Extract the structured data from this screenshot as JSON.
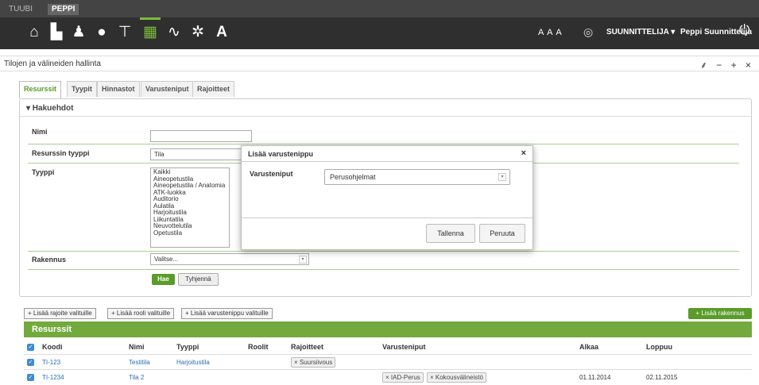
{
  "app": {
    "tabs": [
      "TUUBI",
      "PEPPI"
    ],
    "active_tab": "PEPPI"
  },
  "nav": {
    "icons": [
      "home-icon",
      "copy-icon",
      "person-icon",
      "lightbulb-icon",
      "podium-icon",
      "calendar-icon",
      "pulse-icon",
      "gear-icon",
      "font-icon"
    ],
    "text_size": "A A A",
    "role": "SUUNNITTELIJA ▾",
    "user": "Peppi Suunnittelija"
  },
  "page": {
    "title": "Tilojen ja välineiden hallinta",
    "controls": "⸙ − + ×"
  },
  "tabs": [
    "Resurssit",
    "Tyypit",
    "Hinnastot",
    "Varusteniput",
    "Rajoitteet"
  ],
  "search": {
    "heading": "▾ Hakuehdot",
    "name_label": "Nimi",
    "name_value": "",
    "resource_type_label": "Resurssin tyyppi",
    "resource_type_value": "Tila",
    "type_label": "Tyyppi",
    "type_options": [
      "Kaikki",
      "Aineopetustila",
      "Aineopetustila / Anatomia",
      "ATK-luokka",
      "Auditorio",
      "Aulatila",
      "Harjoitustila",
      "Liikuntatila",
      "Neuvottelutila",
      "Opetustila"
    ],
    "building_label": "Rakennus",
    "building_value": "Valitse...",
    "search_button": "Hae",
    "clear_button": "Tyhjennä"
  },
  "actions": {
    "add_restriction": "+ Lisää rajoite valituille",
    "add_role": "+ Lisää rooli valituille",
    "add_equipment": "+ Lisää varustenippu valituille",
    "add_building": "+ Lisää rakennus"
  },
  "results": {
    "title": "Resurssit",
    "columns": [
      "Koodi",
      "Nimi",
      "Tyyppi",
      "Roolit",
      "Rajoitteet",
      "Varusteniput",
      "Alkaa",
      "Loppuu"
    ],
    "rows": [
      {
        "code": "TI-123",
        "name": "Testitila",
        "type": "Harjoitustila",
        "roles": "",
        "restriction": "× Suursiivous",
        "equipment1": "",
        "equipment2": "",
        "start": "",
        "end": ""
      },
      {
        "code": "TI-1234",
        "name": "Tila 2",
        "type": "",
        "roles": "",
        "restriction": "",
        "equipment1": "× IAD-Perus",
        "equipment2": "× Kokousvälineistö",
        "start": "01.11.2014",
        "end": "02.11.2015"
      }
    ]
  },
  "modal": {
    "title": "Lisää varustenippu",
    "close": "×",
    "label": "Varusteniput",
    "selected": "Perusohjelmat",
    "save": "Tallenna",
    "cancel": "Peruuta"
  }
}
